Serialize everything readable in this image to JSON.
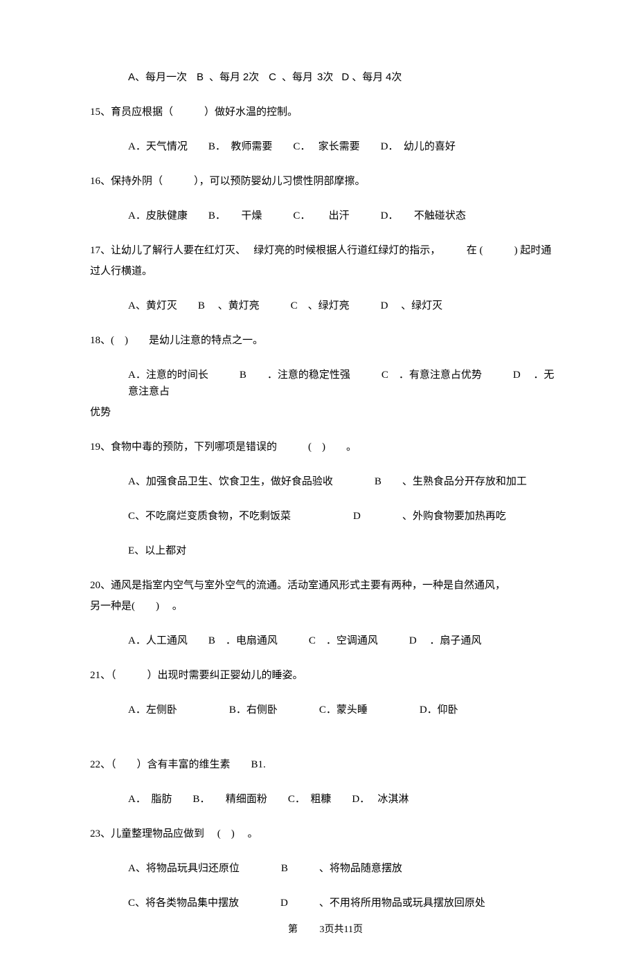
{
  "q14_options": "A、每月一次　 B  、每月 2次　 C  、每月  3次　D 、每月 4次",
  "q15": "15、育员应根据（　　　）做好水温的控制。",
  "q15_options": "A．天气情况　　B．　教师需要　　C．　 家长需要　　D．　幼儿的喜好",
  "q16": "16、保持外阴（　　　），可以预防婴幼儿习惯性阴部摩擦。",
  "q16_options": "A．皮肤健康　　B．　　干燥　　　C．　　 出汗　　　D．　　不触碰状态",
  "q17a": "17、让幼儿了解行人要在红灯灭、　 绿灯亮的时候根据人行道红绿灯的指示，　　　在 (　　　) 起时通",
  "q17b": "过人行横道。",
  "q17_options": "A、黄灯灭　　B　 、黄灯亮　　　C　、绿灯亮　　　D　 、绿灯灭",
  "q18": "18、(　)　　是幼儿注意的特点之一。",
  "q18_opt_a": "A．注意的时间长　　　B　　．注意的稳定性强　　　C　．有意注意占优势　　　D　 ．无意注意占",
  "q18_opt_b": "优势",
  "q19": "19、食物中毒的预防，下列哪项是错误的　　　(　)　　。",
  "q19_opt1": "A、加强食品卫生、饮食卫生，做好食品验收　　　　B　　、生熟食品分开存放和加工",
  "q19_opt2": "C、不吃腐烂变质食物，不吃剩饭菜　　　　　　D　　　　、外购食物要加热再吃",
  "q19_opt3": "E、以上都对",
  "q20a": "20、通风是指室内空气与室外空气的流通。活动室通风形式主要有两种，一种是自然通风，",
  "q20b": "另一种是(　　)　 。",
  "q20_options": "A．人工通风　　B　．电扇通风　　　C　．空调通风　　　D　 ．扇子通风",
  "q21": "21、（　　　）出现时需要纠正婴幼儿的睡姿。",
  "q21_options": "A．左侧卧　　　　　B．右侧卧　　　　C．蒙头睡　　　　　D．仰卧",
  "q22": "22、（　　）含有丰富的维生素　　B1.",
  "q22_options": "A．　脂肪　　B．　　精细面粉　　C．　粗糠　　D．　 冰淇淋",
  "q23": "23、儿童整理物品应做到　  (　)　 。",
  "q23_opt1": "A、将物品玩具归还原位　　　　B　　　、将物品随意摆放",
  "q23_opt2": "C、将各类物品集中摆放　　　　D　　　、不用将所用物品或玩具摆放回原处",
  "footer": "第　　  3页共11页"
}
